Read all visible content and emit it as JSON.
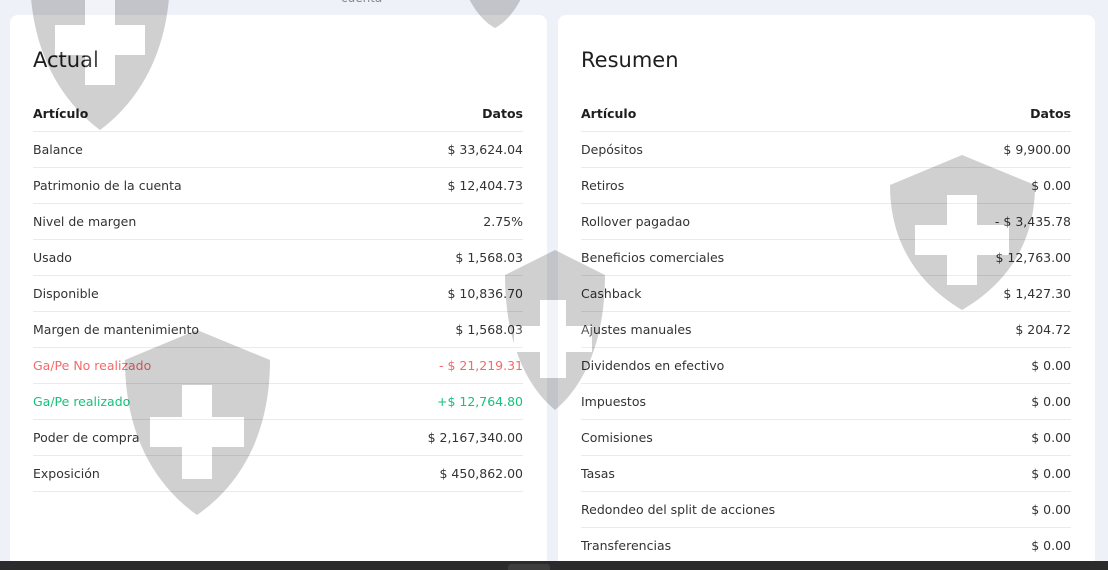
{
  "top_strip": {
    "cut_label": "cuenta"
  },
  "actual": {
    "title": "Actual",
    "header": {
      "item": "Artículo",
      "data": "Datos"
    },
    "rows": [
      {
        "label": "Balance",
        "value": "$ 33,624.04"
      },
      {
        "label": "Patrimonio de la cuenta",
        "value": "$ 12,404.73"
      },
      {
        "label": "Nivel de margen",
        "value": "2.75%"
      },
      {
        "label": "Usado",
        "value": "$ 1,568.03"
      },
      {
        "label": "Disponible",
        "value": "$ 10,836.70"
      },
      {
        "label": "Margen de mantenimiento",
        "value": "$ 1,568.03"
      },
      {
        "label": "Ga/Pe No realizado",
        "value": "- $ 21,219.31"
      },
      {
        "label": "Ga/Pe realizado",
        "value": "+$ 12,764.80"
      },
      {
        "label": "Poder de compra",
        "value": "$ 2,167,340.00"
      },
      {
        "label": "Exposición",
        "value": "$ 450,862.00"
      }
    ]
  },
  "resumen": {
    "title": "Resumen",
    "header": {
      "item": "Artículo",
      "data": "Datos"
    },
    "rows": [
      {
        "label": "Depósitos",
        "value": "$ 9,900.00"
      },
      {
        "label": "Retiros",
        "value": "$ 0.00"
      },
      {
        "label": "Rollover pagadao",
        "value": "- $ 3,435.78"
      },
      {
        "label": "Beneficios comerciales",
        "value": "$ 12,763.00"
      },
      {
        "label": "Cashback",
        "value": "$ 1,427.30"
      },
      {
        "label": "Ajustes manuales",
        "value": "$ 204.72"
      },
      {
        "label": "Dividendos en efectivo",
        "value": "$ 0.00"
      },
      {
        "label": "Impuestos",
        "value": "$ 0.00"
      },
      {
        "label": "Comisiones",
        "value": "$ 0.00"
      },
      {
        "label": "Tasas",
        "value": "$ 0.00"
      },
      {
        "label": "Redondeo del split de acciones",
        "value": "$ 0.00"
      },
      {
        "label": "Transferencias",
        "value": "$ 0.00"
      }
    ]
  },
  "colors": {
    "negative": "#f26b6b",
    "positive": "#16c27a",
    "watermark": "#000000"
  },
  "icons": {
    "watermark": "shield-cross-icon"
  }
}
